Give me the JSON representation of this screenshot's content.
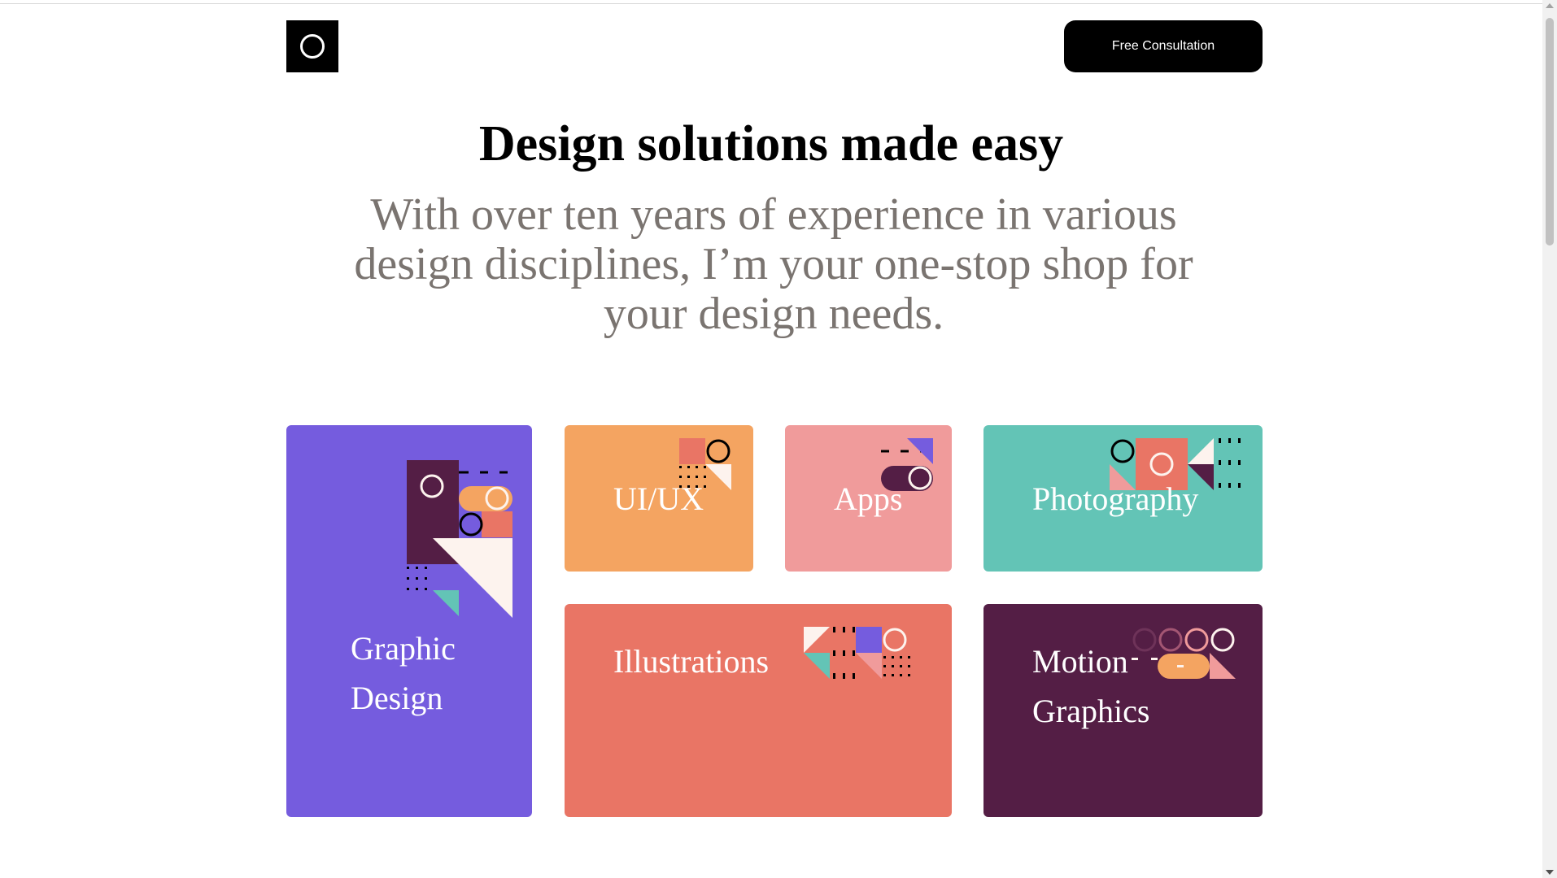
{
  "header": {
    "logo_icon": "ring-logo-icon",
    "cta_label": "Free Consultation"
  },
  "hero": {
    "title": "Design solutions made easy",
    "subtitle": "With over ten years of experience in various design disciplines, I’m your one-stop shop for your design needs."
  },
  "services": [
    {
      "label": "Graphic Design",
      "color": "#755cde"
    },
    {
      "label": "UI/UX",
      "color": "#f4a461"
    },
    {
      "label": "Apps",
      "color": "#f09b9b"
    },
    {
      "label": "Photography",
      "color": "#63c4b6"
    },
    {
      "label": "Illustrations",
      "color": "#e97565"
    },
    {
      "label": "Motion Graphics",
      "color": "#541e45"
    }
  ],
  "palette": {
    "black": "#000000",
    "muted_text": "#7a7470",
    "plum": "#541e45",
    "cream": "#fdf3ee"
  }
}
